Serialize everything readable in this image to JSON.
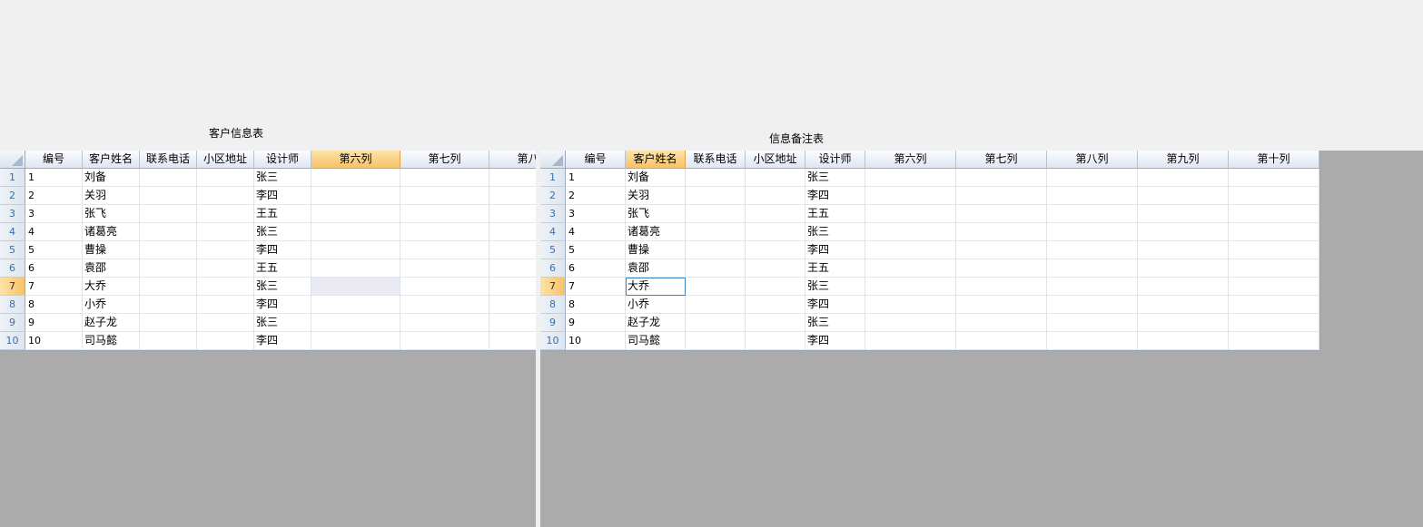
{
  "left": {
    "title": "客户信息表",
    "columns": [
      "编号",
      "客户姓名",
      "联系电话",
      "小区地址",
      "设计师",
      "第六列",
      "第七列",
      "第八列"
    ],
    "selected_column": 5,
    "selected_row": 6,
    "rows": [
      {
        "id": "1",
        "name": "刘备",
        "phone": "",
        "addr": "",
        "designer": "张三"
      },
      {
        "id": "2",
        "name": "关羽",
        "phone": "",
        "addr": "",
        "designer": "李四"
      },
      {
        "id": "3",
        "name": "张飞",
        "phone": "",
        "addr": "",
        "designer": "王五"
      },
      {
        "id": "4",
        "name": "诸葛亮",
        "phone": "",
        "addr": "",
        "designer": "张三"
      },
      {
        "id": "5",
        "name": "曹操",
        "phone": "",
        "addr": "",
        "designer": "李四"
      },
      {
        "id": "6",
        "name": "袁邵",
        "phone": "",
        "addr": "",
        "designer": "王五"
      },
      {
        "id": "7",
        "name": "大乔",
        "phone": "",
        "addr": "",
        "designer": "张三"
      },
      {
        "id": "8",
        "name": "小乔",
        "phone": "",
        "addr": "",
        "designer": "李四"
      },
      {
        "id": "9",
        "name": "赵子龙",
        "phone": "",
        "addr": "",
        "designer": "张三"
      },
      {
        "id": "10",
        "name": "司马懿",
        "phone": "",
        "addr": "",
        "designer": "李四"
      }
    ],
    "row_headers": [
      "1",
      "2",
      "3",
      "4",
      "5",
      "6",
      "7",
      "8",
      "9",
      "10"
    ]
  },
  "right": {
    "title": "信息备注表",
    "columns": [
      "编号",
      "客户姓名",
      "联系电话",
      "小区地址",
      "设计师",
      "第六列",
      "第七列",
      "第八列",
      "第九列",
      "第十列"
    ],
    "selected_column": 1,
    "selected_row": 6,
    "rows": [
      {
        "id": "1",
        "name": "刘备",
        "phone": "",
        "addr": "",
        "designer": "张三"
      },
      {
        "id": "2",
        "name": "关羽",
        "phone": "",
        "addr": "",
        "designer": "李四"
      },
      {
        "id": "3",
        "name": "张飞",
        "phone": "",
        "addr": "",
        "designer": "王五"
      },
      {
        "id": "4",
        "name": "诸葛亮",
        "phone": "",
        "addr": "",
        "designer": "张三"
      },
      {
        "id": "5",
        "name": "曹操",
        "phone": "",
        "addr": "",
        "designer": "李四"
      },
      {
        "id": "6",
        "name": "袁邵",
        "phone": "",
        "addr": "",
        "designer": "王五"
      },
      {
        "id": "7",
        "name": "大乔",
        "phone": "",
        "addr": "",
        "designer": "张三"
      },
      {
        "id": "8",
        "name": "小乔",
        "phone": "",
        "addr": "",
        "designer": "李四"
      },
      {
        "id": "9",
        "name": "赵子龙",
        "phone": "",
        "addr": "",
        "designer": "张三"
      },
      {
        "id": "10",
        "name": "司马懿",
        "phone": "",
        "addr": "",
        "designer": "李四"
      }
    ],
    "row_headers": [
      "1",
      "2",
      "3",
      "4",
      "5",
      "6",
      "7",
      "8",
      "9",
      "10"
    ]
  },
  "colors": {
    "selected_header": "#f6c26a",
    "panel_background": "#ababab",
    "edit_border": "#3d83c4"
  }
}
